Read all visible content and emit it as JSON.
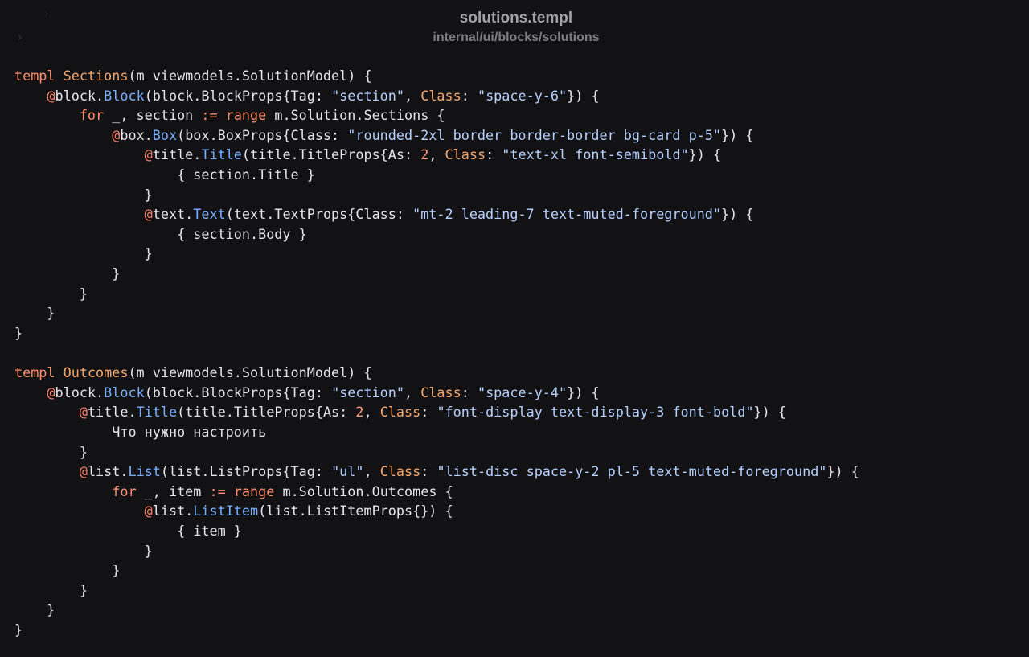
{
  "header": {
    "file_name": "solutions.templ",
    "file_path": "internal/ui/blocks/solutions"
  },
  "colors": {
    "background": "#121215",
    "text": "#e6e6ea",
    "keyword": "#ff8f6b",
    "function": "#79b0ff",
    "string": "#b6d0ff"
  },
  "code_lines": [
    [
      [
        "keyword",
        "templ "
      ],
      [
        "name",
        "Sections"
      ],
      [
        "default",
        "(m viewmodels.SolutionModel) {"
      ]
    ],
    [
      [
        "default",
        "    "
      ],
      [
        "at",
        "@"
      ],
      [
        "default",
        "block."
      ],
      [
        "fn",
        "Block"
      ],
      [
        "default",
        "(block.BlockProps{Tag: "
      ],
      [
        "string",
        "\"section\""
      ],
      [
        "default",
        ", "
      ],
      [
        "prop",
        "Class"
      ],
      [
        "default",
        ": "
      ],
      [
        "string",
        "\"space-y-6\""
      ],
      [
        "default",
        "}) {"
      ]
    ],
    [
      [
        "default",
        "        "
      ],
      [
        "keyword",
        "for"
      ],
      [
        "default",
        " _, section "
      ],
      [
        "keyword",
        ":="
      ],
      [
        "default",
        " "
      ],
      [
        "keyword",
        "range"
      ],
      [
        "default",
        " m.Solution.Sections {"
      ]
    ],
    [
      [
        "default",
        "            "
      ],
      [
        "at",
        "@"
      ],
      [
        "default",
        "box."
      ],
      [
        "fn",
        "Box"
      ],
      [
        "default",
        "(box.BoxProps{Class: "
      ],
      [
        "string",
        "\"rounded-2xl border border-border bg-card p-5\""
      ],
      [
        "default",
        "}) {"
      ]
    ],
    [
      [
        "default",
        "                "
      ],
      [
        "at",
        "@"
      ],
      [
        "default",
        "title."
      ],
      [
        "fn",
        "Title"
      ],
      [
        "default",
        "(title.TitleProps{As: "
      ],
      [
        "number",
        "2"
      ],
      [
        "default",
        ", "
      ],
      [
        "prop",
        "Class"
      ],
      [
        "default",
        ": "
      ],
      [
        "string",
        "\"text-xl font-semibold\""
      ],
      [
        "default",
        "}) {"
      ]
    ],
    [
      [
        "default",
        "                    { section.Title }"
      ]
    ],
    [
      [
        "default",
        "                }"
      ]
    ],
    [
      [
        "default",
        "                "
      ],
      [
        "at",
        "@"
      ],
      [
        "default",
        "text."
      ],
      [
        "fn",
        "Text"
      ],
      [
        "default",
        "(text.TextProps{Class: "
      ],
      [
        "string",
        "\"mt-2 leading-7 text-muted-foreground\""
      ],
      [
        "default",
        "}) {"
      ]
    ],
    [
      [
        "default",
        "                    { section.Body }"
      ]
    ],
    [
      [
        "default",
        "                }"
      ]
    ],
    [
      [
        "default",
        "            }"
      ]
    ],
    [
      [
        "default",
        "        }"
      ]
    ],
    [
      [
        "default",
        "    }"
      ]
    ],
    [
      [
        "default",
        "}"
      ]
    ],
    [
      [
        "default",
        ""
      ]
    ],
    [
      [
        "keyword",
        "templ "
      ],
      [
        "name",
        "Outcomes"
      ],
      [
        "default",
        "(m viewmodels.SolutionModel) {"
      ]
    ],
    [
      [
        "default",
        "    "
      ],
      [
        "at",
        "@"
      ],
      [
        "default",
        "block."
      ],
      [
        "fn",
        "Block"
      ],
      [
        "default",
        "(block.BlockProps{Tag: "
      ],
      [
        "string",
        "\"section\""
      ],
      [
        "default",
        ", "
      ],
      [
        "prop",
        "Class"
      ],
      [
        "default",
        ": "
      ],
      [
        "string",
        "\"space-y-4\""
      ],
      [
        "default",
        "}) {"
      ]
    ],
    [
      [
        "default",
        "        "
      ],
      [
        "at",
        "@"
      ],
      [
        "default",
        "title."
      ],
      [
        "fn",
        "Title"
      ],
      [
        "default",
        "(title.TitleProps{As: "
      ],
      [
        "number",
        "2"
      ],
      [
        "default",
        ", "
      ],
      [
        "prop",
        "Class"
      ],
      [
        "default",
        ": "
      ],
      [
        "string",
        "\"font-display text-display-3 font-bold\""
      ],
      [
        "default",
        "}) {"
      ]
    ],
    [
      [
        "default",
        "            Что нужно настроить"
      ]
    ],
    [
      [
        "default",
        "        }"
      ]
    ],
    [
      [
        "default",
        "        "
      ],
      [
        "at",
        "@"
      ],
      [
        "default",
        "list."
      ],
      [
        "fn",
        "List"
      ],
      [
        "default",
        "(list.ListProps{Tag: "
      ],
      [
        "string",
        "\"ul\""
      ],
      [
        "default",
        ", "
      ],
      [
        "prop",
        "Class"
      ],
      [
        "default",
        ": "
      ],
      [
        "string",
        "\"list-disc space-y-2 pl-5 text-muted-foreground\""
      ],
      [
        "default",
        "}) {"
      ]
    ],
    [
      [
        "default",
        "            "
      ],
      [
        "keyword",
        "for"
      ],
      [
        "default",
        " _, item "
      ],
      [
        "keyword",
        ":="
      ],
      [
        "default",
        " "
      ],
      [
        "keyword",
        "range"
      ],
      [
        "default",
        " m.Solution.Outcomes {"
      ]
    ],
    [
      [
        "default",
        "                "
      ],
      [
        "at",
        "@"
      ],
      [
        "default",
        "list."
      ],
      [
        "fn",
        "ListItem"
      ],
      [
        "default",
        "(list.ListItemProps{}) {"
      ]
    ],
    [
      [
        "default",
        "                    { item }"
      ]
    ],
    [
      [
        "default",
        "                }"
      ]
    ],
    [
      [
        "default",
        "            }"
      ]
    ],
    [
      [
        "default",
        "        }"
      ]
    ],
    [
      [
        "default",
        "    }"
      ]
    ],
    [
      [
        "default",
        "}"
      ]
    ]
  ]
}
